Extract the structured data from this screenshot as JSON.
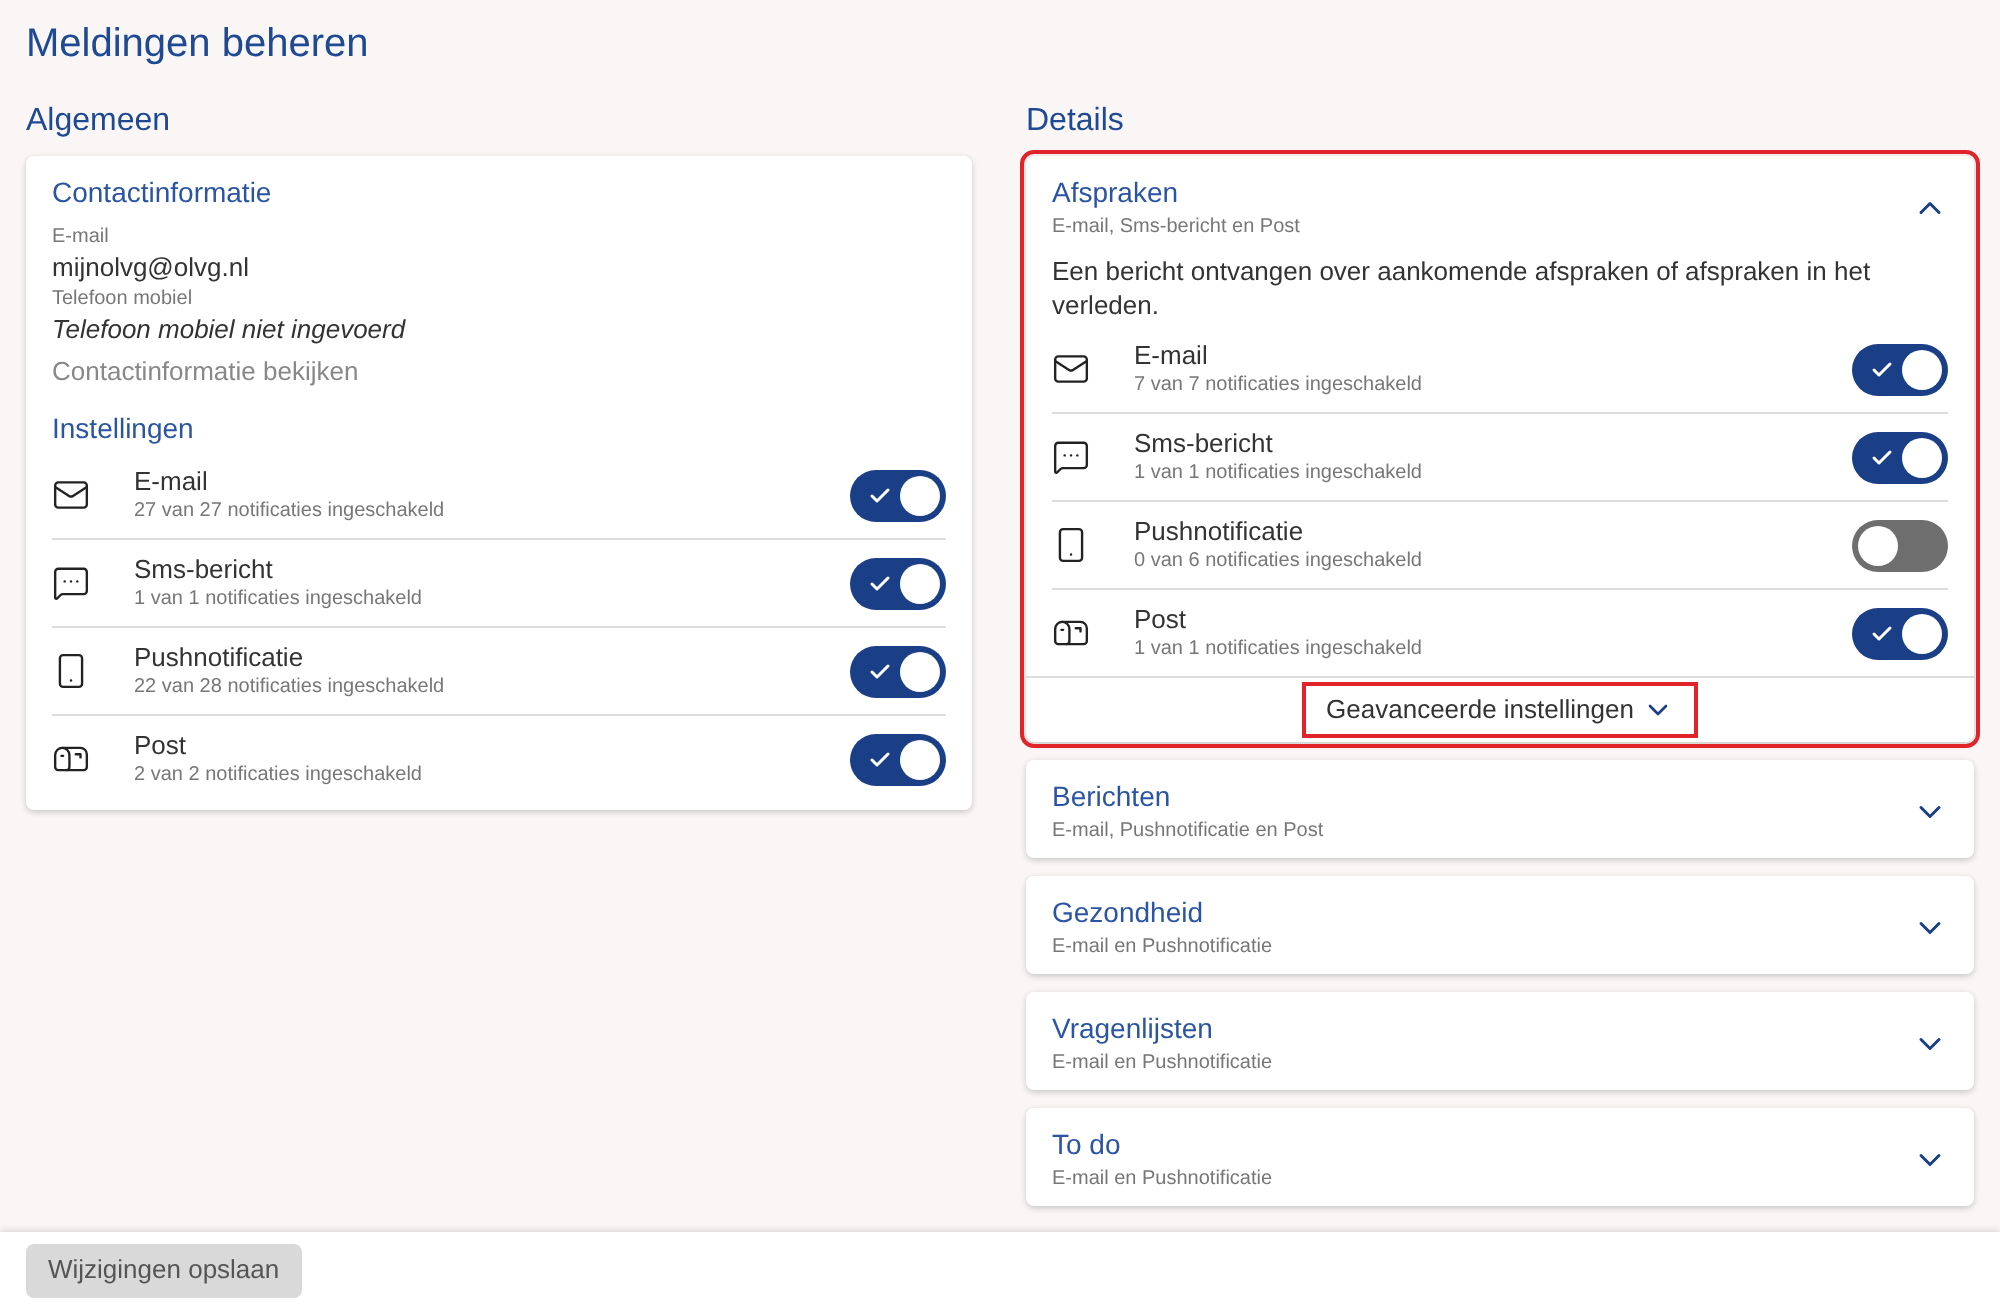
{
  "page": {
    "title": "Meldingen beheren"
  },
  "general": {
    "heading": "Algemeen",
    "contact": {
      "heading": "Contactinformatie",
      "fields": [
        {
          "label": "E-mail",
          "value": "mijnolvg@olvg.nl",
          "missing": false
        },
        {
          "label": "Telefoon mobiel",
          "value": "Telefoon mobiel niet ingevoerd",
          "missing": true
        }
      ],
      "link": "Contactinformatie bekijken"
    },
    "settings_heading": "Instellingen",
    "channels": [
      {
        "kind": "email",
        "name": "E-mail",
        "count": "27 van 27 notificaties ingeschakeld",
        "on": true
      },
      {
        "kind": "sms",
        "name": "Sms-bericht",
        "count": "1 van 1 notificaties ingeschakeld",
        "on": true
      },
      {
        "kind": "push",
        "name": "Pushnotificatie",
        "count": "22 van 28 notificaties ingeschakeld",
        "on": true
      },
      {
        "kind": "post",
        "name": "Post",
        "count": "2 van 2 notificaties ingeschakeld",
        "on": true
      }
    ]
  },
  "details": {
    "heading": "Details",
    "sections": [
      {
        "title": "Afspraken",
        "subtitle": "E-mail, Sms-bericht en Post",
        "expanded": true,
        "highlighted": true,
        "description": "Een bericht ontvangen over aankomende afspraken of afspraken in het verleden.",
        "channels": [
          {
            "kind": "email",
            "name": "E-mail",
            "count": "7 van 7 notificaties ingeschakeld",
            "on": true
          },
          {
            "kind": "sms",
            "name": "Sms-bericht",
            "count": "1 van 1 notificaties ingeschakeld",
            "on": true
          },
          {
            "kind": "push",
            "name": "Pushnotificatie",
            "count": "0 van 6 notificaties ingeschakeld",
            "on": false
          },
          {
            "kind": "post",
            "name": "Post",
            "count": "1 van 1 notificaties ingeschakeld",
            "on": true
          }
        ],
        "advanced": {
          "label": "Geavanceerde instellingen",
          "highlighted": true
        }
      },
      {
        "title": "Berichten",
        "subtitle": "E-mail, Pushnotificatie en Post",
        "expanded": false,
        "highlighted": false
      },
      {
        "title": "Gezondheid",
        "subtitle": "E-mail en Pushnotificatie",
        "expanded": false,
        "highlighted": false
      },
      {
        "title": "Vragenlijsten",
        "subtitle": "E-mail en Pushnotificatie",
        "expanded": false,
        "highlighted": false
      },
      {
        "title": "To do",
        "subtitle": "E-mail en Pushnotificatie",
        "expanded": false,
        "highlighted": false
      }
    ]
  },
  "footer": {
    "save_button": "Wijzigingen opslaan"
  }
}
